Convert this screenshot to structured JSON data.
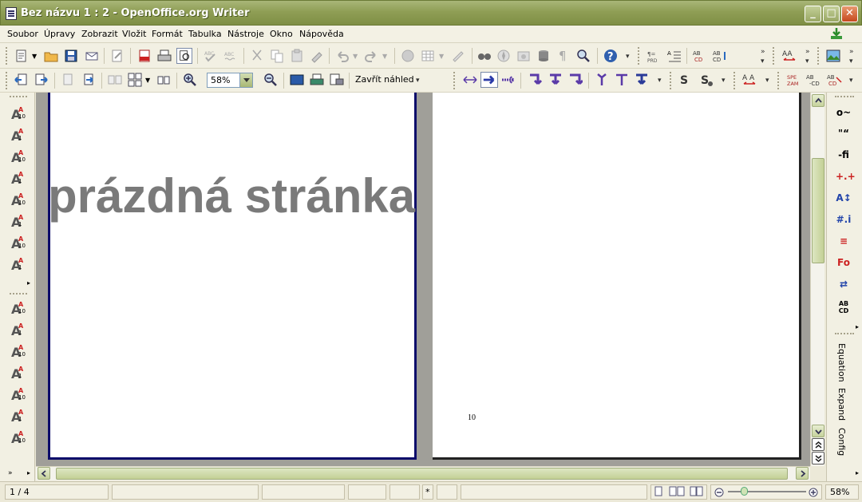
{
  "window": {
    "title": "Bez názvu 1 : 2 - OpenOffice.org Writer",
    "controls": {
      "minimize": "_",
      "maximize": "□",
      "close": "✕"
    }
  },
  "menu": {
    "items": [
      "Soubor",
      "Úpravy",
      "Zobrazit",
      "Vložit",
      "Formát",
      "Tabulka",
      "Nástroje",
      "Okno",
      "Nápověda"
    ]
  },
  "toolbar_standard": {
    "icons": [
      "new-document-icon",
      "open-folder-icon",
      "save-icon",
      "email-icon",
      "edit-file-icon",
      "export-pdf-icon",
      "print-icon",
      "page-preview-icon",
      "spellcheck-icon",
      "autospellcheck-icon",
      "cut-icon",
      "copy-icon",
      "paste-icon",
      "clone-format-icon",
      "undo-icon",
      "redo-icon",
      "hyperlink-icon",
      "table-icon",
      "draw-functions-icon",
      "find-replace-icon",
      "navigator-icon",
      "gallery-icon",
      "data-sources-icon",
      "nonprinting-chars-icon",
      "zoom-icon",
      "help-icon"
    ]
  },
  "toolbar_preview": {
    "zoom_value": "58%",
    "close_preview_label": "Zavřít náhled"
  },
  "document": {
    "page1_heading": "prázdná stránka",
    "page2_number": "10"
  },
  "right_panel": {
    "vertical_labels": [
      "Equation",
      "Expand",
      "Config"
    ]
  },
  "left_panel": {
    "group1": [
      {
        "num": "10"
      },
      {
        "num": "1"
      },
      {
        "num": "10"
      },
      {
        "num": "1"
      },
      {
        "num": "10"
      },
      {
        "num": "1"
      },
      {
        "num": "10"
      },
      {
        "num": "1"
      }
    ],
    "group2": [
      {
        "num": "10"
      },
      {
        "num": "1"
      },
      {
        "num": "10"
      },
      {
        "num": "1"
      },
      {
        "num": "10"
      },
      {
        "num": "1"
      },
      {
        "num": "10"
      }
    ]
  },
  "status": {
    "page": "1 / 4",
    "modified": "*",
    "zoom": "58%"
  }
}
